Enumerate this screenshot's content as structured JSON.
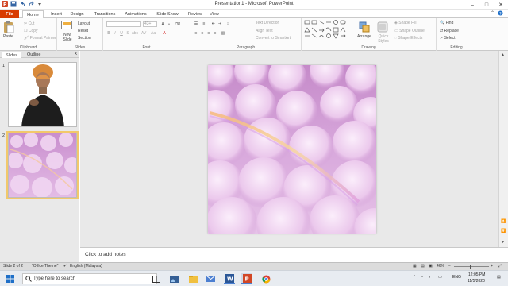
{
  "window": {
    "title": "Presentation1 - Microsoft PowerPoint"
  },
  "window_buttons": [
    "–",
    "□",
    "✕"
  ],
  "tabs": [
    "File",
    "Home",
    "Insert",
    "Design",
    "Transitions",
    "Animations",
    "Slide Show",
    "Review",
    "View"
  ],
  "ribbon": {
    "clipboard": {
      "paste": "Paste",
      "cut": "Cut",
      "copy": "Copy",
      "format_painter": "Format Painter",
      "label": "Clipboard"
    },
    "slides": {
      "new_slide": "New Slide",
      "layout": "Layout",
      "reset": "Reset",
      "section": "Section",
      "label": "Slides"
    },
    "font": {
      "font_size": "43+",
      "label": "Font"
    },
    "paragraph": {
      "text_direction": "Text Direction",
      "align_text": "Align Text",
      "convert_smartart": "Convert to SmartArt",
      "label": "Paragraph"
    },
    "drawing": {
      "arrange": "Arrange",
      "quick_styles": "Quick Styles",
      "shape_fill": "Shape Fill",
      "shape_outline": "Shape Outline",
      "shape_effects": "Shape Effects",
      "label": "Drawing"
    },
    "editing": {
      "find": "Find",
      "replace": "Replace",
      "select": "Select",
      "label": "Editing"
    }
  },
  "panel": {
    "tabs": [
      "Slides",
      "Outline"
    ],
    "close": "x",
    "thumb_numbers": [
      "1",
      "2"
    ]
  },
  "notes": {
    "placeholder": "Click to add notes"
  },
  "status": {
    "slide": "Slide 2 of 2",
    "theme": "\"Office Theme\"",
    "language": "English (Malaysia)",
    "zoom": "46%"
  },
  "taskbar": {
    "search_placeholder": "Type here to search",
    "lang": "ENG",
    "time": "12:05 PM",
    "date": "11/5/2020"
  },
  "colors": {
    "file_tab": "#d83b01",
    "cloud": "#d8a8dc",
    "accent_selection": "#f2c86b"
  }
}
